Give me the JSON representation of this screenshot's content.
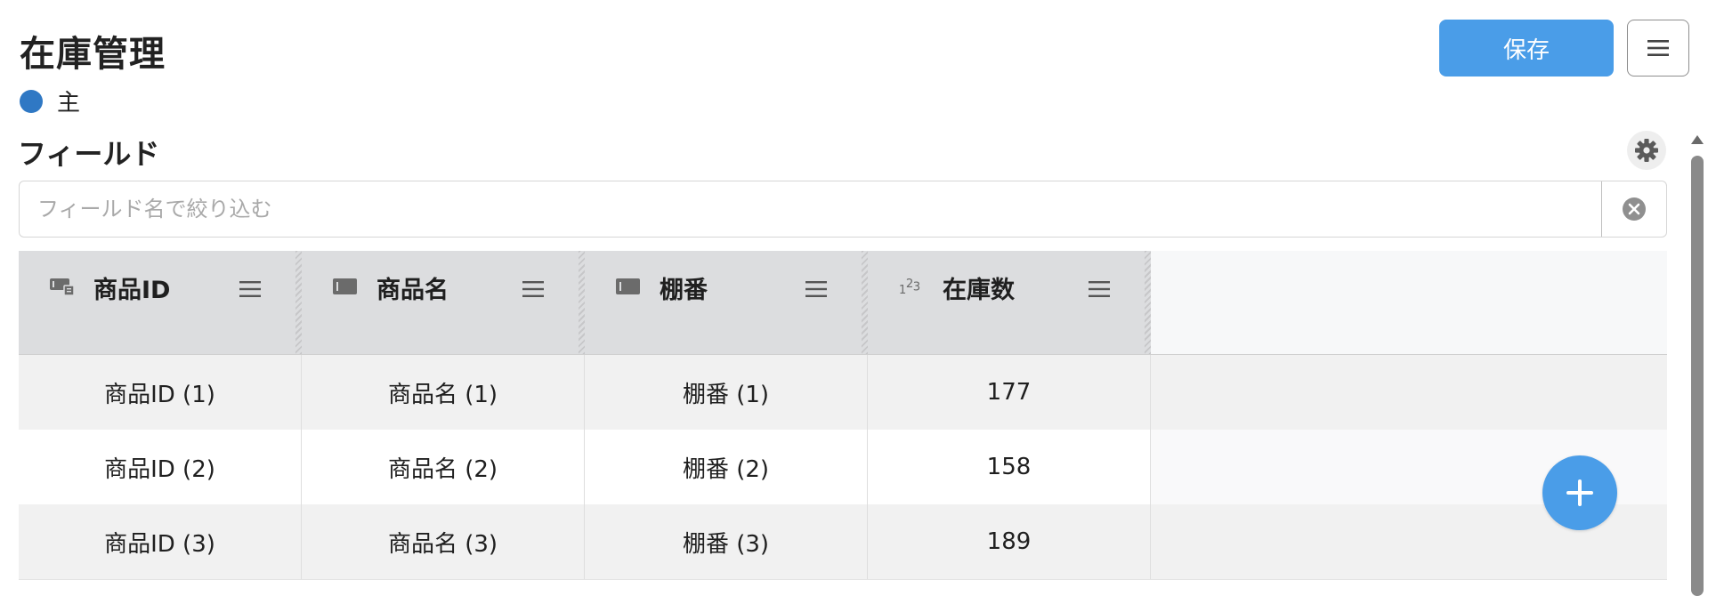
{
  "header": {
    "title": "在庫管理",
    "primary_label": "主",
    "primary_color": "#2f78c4",
    "save_label": "保存",
    "menu_icon": "hamburger-icon"
  },
  "fields": {
    "heading": "フィールド",
    "settings_icon": "gear-icon",
    "filter_placeholder": "フィールド名で絞り込む",
    "filter_value": "",
    "clear_icon": "clear-circle-icon"
  },
  "table": {
    "columns": [
      {
        "label": "商品ID",
        "type_icon": "id-field-icon",
        "tools": []
      },
      {
        "label": "商品名",
        "type_icon": "text-field-icon",
        "tools": [
          "search-icon",
          "sort-icon",
          "chart-icon"
        ]
      },
      {
        "label": "棚番",
        "type_icon": "text-field-icon",
        "tools": [
          "search-icon",
          "sort-icon",
          "chart-icon"
        ]
      },
      {
        "label": "在庫数",
        "type_icon": "number-field-icon",
        "tools": []
      }
    ],
    "rows": [
      [
        "商品ID (1)",
        "商品名 (1)",
        "棚番 (1)",
        "177"
      ],
      [
        "商品ID (2)",
        "商品名 (2)",
        "棚番 (2)",
        "158"
      ],
      [
        "商品ID (3)",
        "商品名 (3)",
        "棚番 (3)",
        "189"
      ]
    ]
  },
  "fab": {
    "icon": "plus-icon"
  },
  "colors": {
    "accent": "#4a9de8",
    "header_bg": "#dcdddf"
  }
}
